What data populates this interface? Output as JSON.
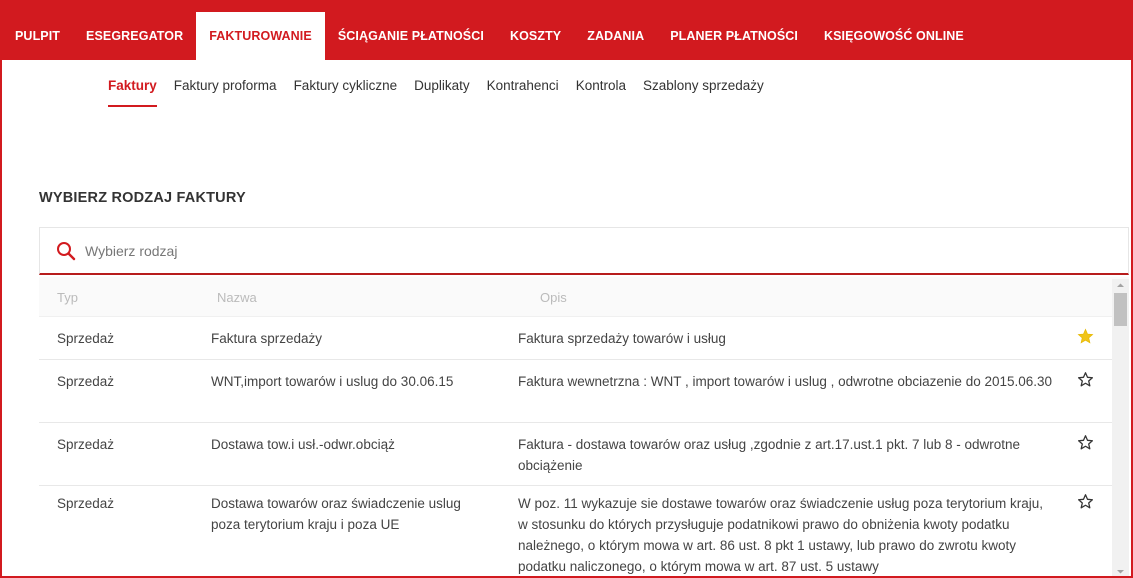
{
  "topnav": {
    "items": [
      {
        "label": "PULPIT"
      },
      {
        "label": "ESEGREGATOR"
      },
      {
        "label": "FAKTUROWANIE"
      },
      {
        "label": "ŚCIĄGANIE PŁATNOŚCI"
      },
      {
        "label": "KOSZTY"
      },
      {
        "label": "ZADANIA"
      },
      {
        "label": "PLANER PŁATNOŚCI"
      },
      {
        "label": "KSIĘGOWOŚĆ ONLINE"
      }
    ],
    "active": "FAKTUROWANIE"
  },
  "subnav": {
    "tabs": [
      {
        "label": "Faktury"
      },
      {
        "label": "Faktury proforma"
      },
      {
        "label": "Faktury cykliczne"
      },
      {
        "label": "Duplikaty"
      },
      {
        "label": "Kontrahenci"
      },
      {
        "label": "Kontrola"
      },
      {
        "label": "Szablony sprzedaży"
      }
    ],
    "active": "Faktury"
  },
  "section": {
    "title": "WYBIERZ RODZAJ FAKTURY"
  },
  "search": {
    "placeholder": "Wybierz rodzaj",
    "value": "",
    "icon": "search-icon"
  },
  "table": {
    "columns": {
      "typ": "Typ",
      "nazwa": "Nazwa",
      "opis": "Opis"
    },
    "rows": [
      {
        "typ": "Sprzedaż",
        "nazwa": "Faktura sprzedaży",
        "opis": "Faktura sprzedaży towarów i usług",
        "favorite": true
      },
      {
        "typ": "Sprzedaż",
        "nazwa": "WNT,import towarów i uslug do 30.06.15",
        "opis": "Faktura wewnetrzna : WNT , import towarów i uslug , odwrotne obciazenie do 2015.06.30",
        "favorite": false
      },
      {
        "typ": "Sprzedaż",
        "nazwa": "Dostawa tow.i usł.-odwr.obciąż",
        "opis": "Faktura - dostawa towarów oraz usług ,zgodnie z art.17.ust.1 pkt. 7 lub 8 - odwrotne obciążenie",
        "favorite": false
      },
      {
        "typ": "Sprzedaż",
        "nazwa": "Dostawa towarów oraz świadczenie uslug poza terytorium kraju i poza UE",
        "opis": "W poz. 11 wykazuje sie dostawe towarów oraz świadczenie usług poza terytorium kraju, w stosunku do których przysługuje podatnikowi prawo do obniżenia kwoty podatku należnego, o którym mowa w art. 86 ust. 8 pkt 1 ustawy, lub prawo do zwrotu kwoty podatku naliczonego, o którym mowa w art. 87 ust. 5 ustawy",
        "favorite": false
      }
    ]
  },
  "colors": {
    "brand": "#d21a1f",
    "star_filled": "#f0c419",
    "star_outline": "#333333"
  }
}
